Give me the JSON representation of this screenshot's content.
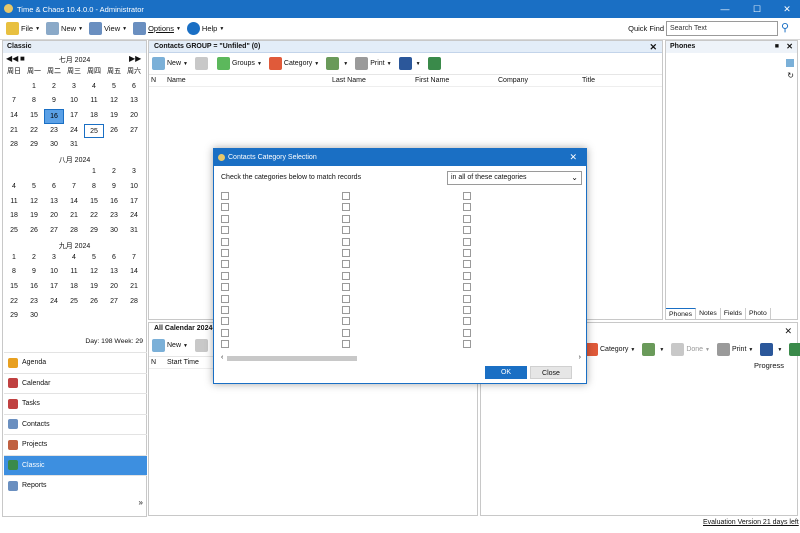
{
  "app": {
    "title": "Time & Chaos 10.4.0.0 - Administrator"
  },
  "menu": {
    "file": "File",
    "new": "New",
    "view": "View",
    "options": "Options",
    "help": "Help",
    "quick_find": "Quick Find",
    "search_placeholder": "Search Text"
  },
  "left": {
    "header": "Classic",
    "weekdays": [
      "周日",
      "周一",
      "周二",
      "周三",
      "周四",
      "周五",
      "周六"
    ],
    "months": [
      {
        "label": "七月 2024",
        "days": [
          "",
          "1",
          "2",
          "3",
          "4",
          "5",
          "6",
          "7",
          "8",
          "9",
          "10",
          "11",
          "12",
          "13",
          "14",
          "15",
          "16",
          "17",
          "18",
          "19",
          "20",
          "21",
          "22",
          "23",
          "24",
          "25",
          "26",
          "27",
          "28",
          "29",
          "30",
          "31",
          "",
          "",
          ""
        ]
      },
      {
        "label": "八月 2024",
        "days": [
          "",
          "",
          "",
          "",
          "1",
          "2",
          "3",
          "4",
          "5",
          "6",
          "7",
          "8",
          "9",
          "10",
          "11",
          "12",
          "13",
          "14",
          "15",
          "16",
          "17",
          "18",
          "19",
          "20",
          "21",
          "22",
          "23",
          "24",
          "25",
          "26",
          "27",
          "28",
          "29",
          "30",
          "31"
        ]
      },
      {
        "label": "九月 2024",
        "days": [
          "1",
          "2",
          "3",
          "4",
          "5",
          "6",
          "7",
          "8",
          "9",
          "10",
          "11",
          "12",
          "13",
          "14",
          "15",
          "16",
          "17",
          "18",
          "19",
          "20",
          "21",
          "22",
          "23",
          "24",
          "25",
          "26",
          "27",
          "28",
          "29",
          "30",
          "",
          "",
          "",
          "",
          ""
        ]
      }
    ],
    "day_stat": "Day: 198  Week: 29",
    "nav": [
      "Agenda",
      "Calendar",
      "Tasks",
      "Contacts",
      "Projects",
      "Classic",
      "Reports"
    ]
  },
  "contacts": {
    "header": "Contacts GROUP = \"Unfiled\" (0)",
    "toolbar": {
      "new": "New",
      "groups": "Groups",
      "category": "Category",
      "print": "Print"
    },
    "columns": [
      "N",
      "Name",
      "Last Name",
      "First Name",
      "Company",
      "Title"
    ]
  },
  "phones": {
    "header": "Phones",
    "tabs": [
      "Phones",
      "Notes",
      "Fields",
      "Photo"
    ]
  },
  "calendar": {
    "header": "All Calendar 2024-07",
    "toolbar": {
      "new": "New",
      "category": "Category",
      "done": "Done",
      "print": "Print"
    },
    "columns": [
      "N",
      "Start Time",
      "Progress"
    ]
  },
  "status": {
    "text": "Evaluation Version 21 days left"
  },
  "dialog": {
    "title": "Contacts Category Selection",
    "instruction": "Check the categories below to match records",
    "match_mode": "in all of these categories",
    "ok": "OK",
    "close": "Close"
  },
  "colors": {
    "accent": "#1a6fc4",
    "selected": "#3d8fe0"
  }
}
